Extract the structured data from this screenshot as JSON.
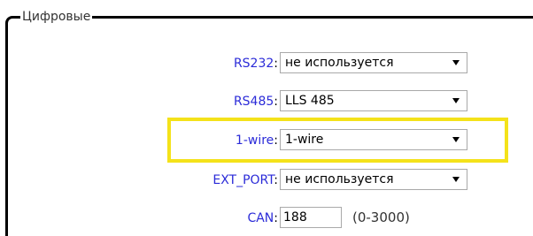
{
  "group": {
    "legend": "Цифровые"
  },
  "fields": {
    "rs232": {
      "label": "RS232",
      "colon": ":",
      "value": "не используется"
    },
    "rs485": {
      "label": "RS485",
      "colon": ":",
      "value": "LLS 485"
    },
    "onewire": {
      "label": "1-wire",
      "colon": ":",
      "value": "1-wire"
    },
    "ext_port": {
      "label": "EXT_PORT",
      "colon": ":",
      "value": "не используется"
    },
    "can": {
      "label": "CAN",
      "colon": ":",
      "value": "188",
      "range": "(0-3000)"
    }
  },
  "colors": {
    "label": "#2b2bd8",
    "highlight": "#f4e21a",
    "border": "#000000"
  },
  "icons": {
    "dropdown": "chevron-down-icon"
  }
}
